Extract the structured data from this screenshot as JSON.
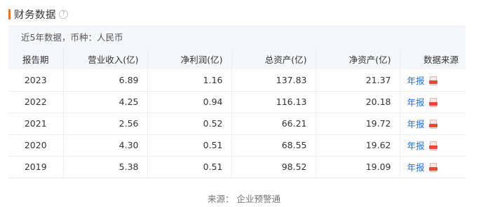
{
  "section": {
    "title": "财务数据",
    "help_icon": "?"
  },
  "note": "近5年数据，币种：人民币",
  "table": {
    "headers": [
      "报告期",
      "营业收入(亿)",
      "净利润(亿)",
      "总资产(亿)",
      "净资产(亿)",
      "数据来源"
    ],
    "rows": [
      {
        "year": "2023",
        "revenue": "6.89",
        "net_profit": "1.16",
        "total_assets": "137.83",
        "net_assets": "21.37",
        "source": "年报"
      },
      {
        "year": "2022",
        "revenue": "4.25",
        "net_profit": "0.94",
        "total_assets": "116.13",
        "net_assets": "20.18",
        "source": "年报"
      },
      {
        "year": "2021",
        "revenue": "2.56",
        "net_profit": "0.52",
        "total_assets": "66.21",
        "net_assets": "19.72",
        "source": "年报"
      },
      {
        "year": "2020",
        "revenue": "4.30",
        "net_profit": "0.51",
        "total_assets": "68.55",
        "net_assets": "19.62",
        "source": "年报"
      },
      {
        "year": "2019",
        "revenue": "5.38",
        "net_profit": "0.51",
        "total_assets": "98.52",
        "net_assets": "19.09",
        "source": "年报"
      }
    ]
  },
  "footer": "来源：  企业预警通",
  "colors": {
    "accent": "#e8742b",
    "link": "#1f6fd6",
    "header_bg": "#f4f6fa",
    "pdf_red": "#e8483a"
  }
}
